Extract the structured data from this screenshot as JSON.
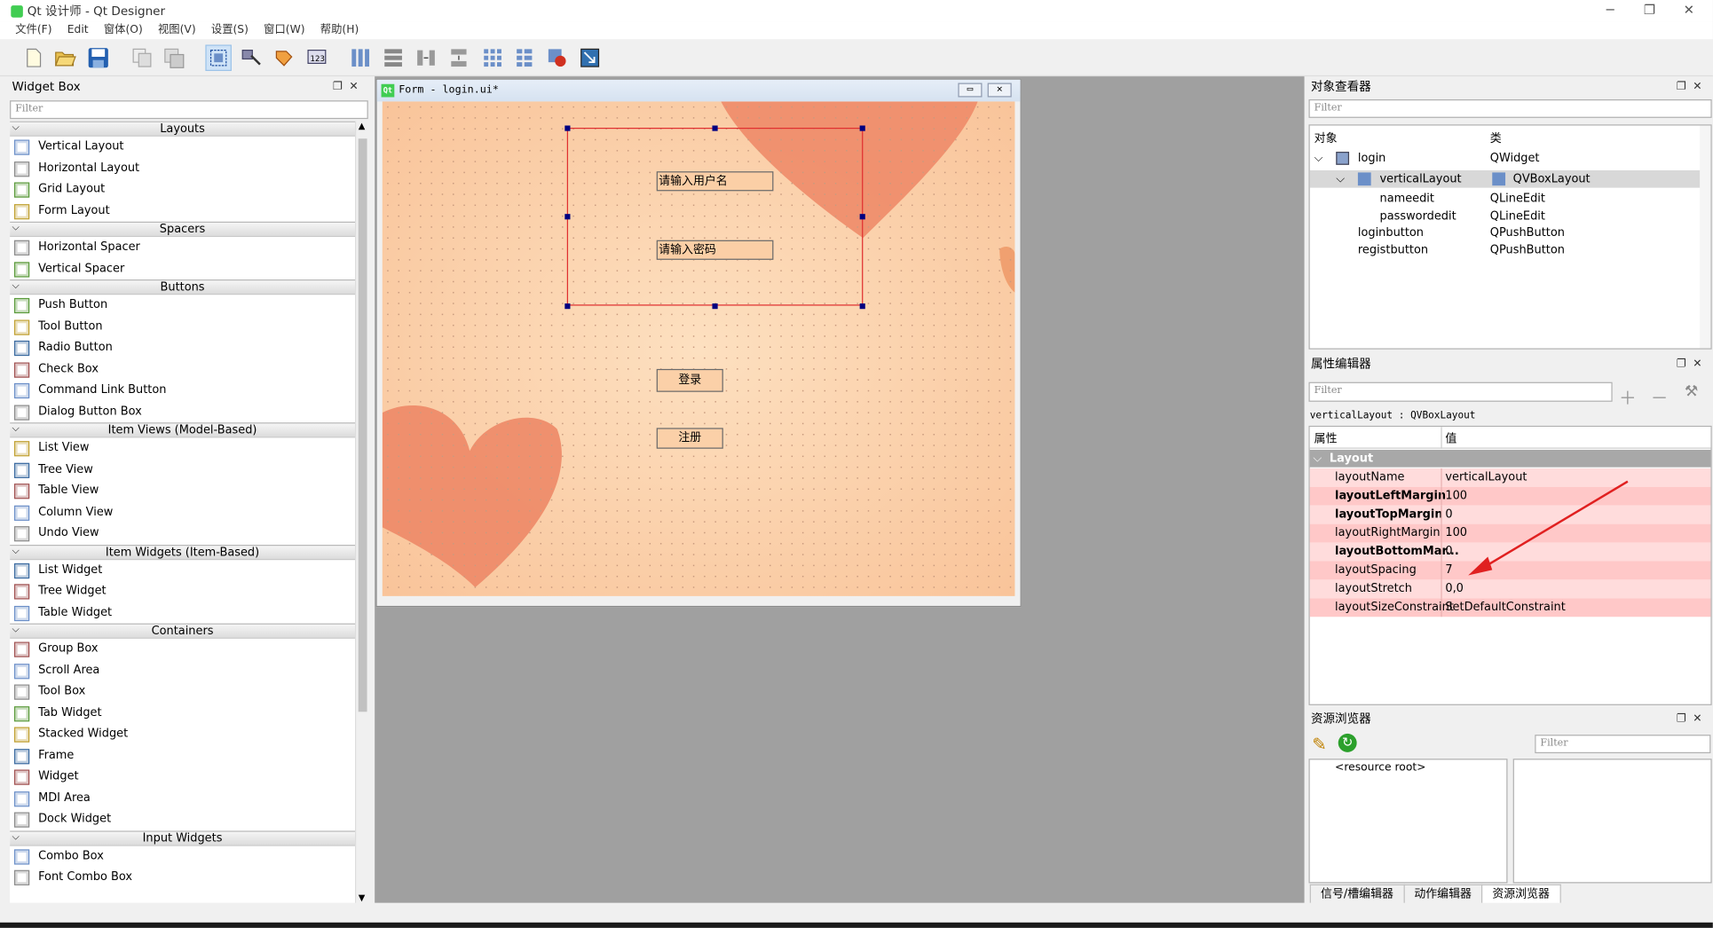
{
  "window": {
    "title": "Qt 设计师 - Qt Designer",
    "controls": [
      "─",
      "❐",
      "✕"
    ]
  },
  "menu": [
    "文件(F)",
    "Edit",
    "窗体(O)",
    "视图(V)",
    "设置(S)",
    "窗口(W)",
    "帮助(H)"
  ],
  "toolbar": {
    "icons": [
      "new-icon",
      "open-icon",
      "save-icon",
      "copy-icon",
      "paste-icon",
      "edit-widgets-icon",
      "edit-signals-icon",
      "edit-buddies-icon",
      "edit-tab-order-icon",
      "layout-horizontal-icon",
      "layout-vertical-icon",
      "layout-horizontal-splitter-icon",
      "layout-vertical-splitter-icon",
      "layout-grid-icon",
      "layout-form-icon",
      "break-layout-icon",
      "adjust-size-icon"
    ]
  },
  "widget_box": {
    "title": "Widget Box",
    "filter_placeholder": "Filter",
    "categories": [
      {
        "name": "Layouts",
        "items": [
          "Vertical Layout",
          "Horizontal Layout",
          "Grid Layout",
          "Form Layout"
        ]
      },
      {
        "name": "Spacers",
        "items": [
          "Horizontal Spacer",
          "Vertical Spacer"
        ]
      },
      {
        "name": "Buttons",
        "items": [
          "Push Button",
          "Tool Button",
          "Radio Button",
          "Check Box",
          "Command Link Button",
          "Dialog Button Box"
        ]
      },
      {
        "name": "Item Views (Model-Based)",
        "items": [
          "List View",
          "Tree View",
          "Table View",
          "Column View",
          "Undo View"
        ]
      },
      {
        "name": "Item Widgets (Item-Based)",
        "items": [
          "List Widget",
          "Tree Widget",
          "Table Widget"
        ]
      },
      {
        "name": "Containers",
        "items": [
          "Group Box",
          "Scroll Area",
          "Tool Box",
          "Tab Widget",
          "Stacked Widget",
          "Frame",
          "Widget",
          "MDI Area",
          "Dock Widget"
        ]
      },
      {
        "name": "Input Widgets",
        "items": [
          "Combo Box",
          "Font Combo Box"
        ]
      }
    ]
  },
  "form": {
    "title": "Form - login.ui*",
    "qt_badge": "Qt",
    "username_text": "请输入用户名",
    "password_text": "请输入密码",
    "login_button": "登录",
    "regist_button": "注册"
  },
  "object_inspector": {
    "title": "对象查看器",
    "filter_placeholder": "Filter",
    "col_object": "对象",
    "col_class": "类",
    "rows": [
      {
        "name": "login",
        "cls": "QWidget"
      },
      {
        "name": "verticalLayout",
        "cls": "QVBoxLayout"
      },
      {
        "name": "nameedit",
        "cls": "QLineEdit"
      },
      {
        "name": "passwordedit",
        "cls": "QLineEdit"
      },
      {
        "name": "loginbutton",
        "cls": "QPushButton"
      },
      {
        "name": "registbutton",
        "cls": "QPushButton"
      }
    ]
  },
  "property_editor": {
    "title": "属性编辑器",
    "filter_placeholder": "Filter",
    "context": "verticalLayout : QVBoxLayout",
    "col_property": "属性",
    "col_value": "值",
    "group": "Layout",
    "rows": [
      {
        "name": "layoutName",
        "value": "verticalLayout"
      },
      {
        "name": "layoutLeftMargin",
        "value": "100"
      },
      {
        "name": "layoutTopMargin",
        "value": "0"
      },
      {
        "name": "layoutRightMargin",
        "value": "100"
      },
      {
        "name": "layoutBottomMar...",
        "value": "0"
      },
      {
        "name": "layoutSpacing",
        "value": "7"
      },
      {
        "name": "layoutStretch",
        "value": "0,0"
      },
      {
        "name": "layoutSizeConstraint",
        "value": "SetDefaultConstraint"
      }
    ]
  },
  "resource_browser": {
    "title": "资源浏览器",
    "filter_placeholder": "Filter",
    "root": "<resource root>"
  },
  "bottom_tabs": [
    "信号/槽编辑器",
    "动作编辑器",
    "资源浏览器"
  ],
  "colors": {
    "accent": "#41cd52",
    "selection": "#e03030",
    "modified_row": "#ffc8c8",
    "modified_row_alt": "#ffdcdc"
  }
}
